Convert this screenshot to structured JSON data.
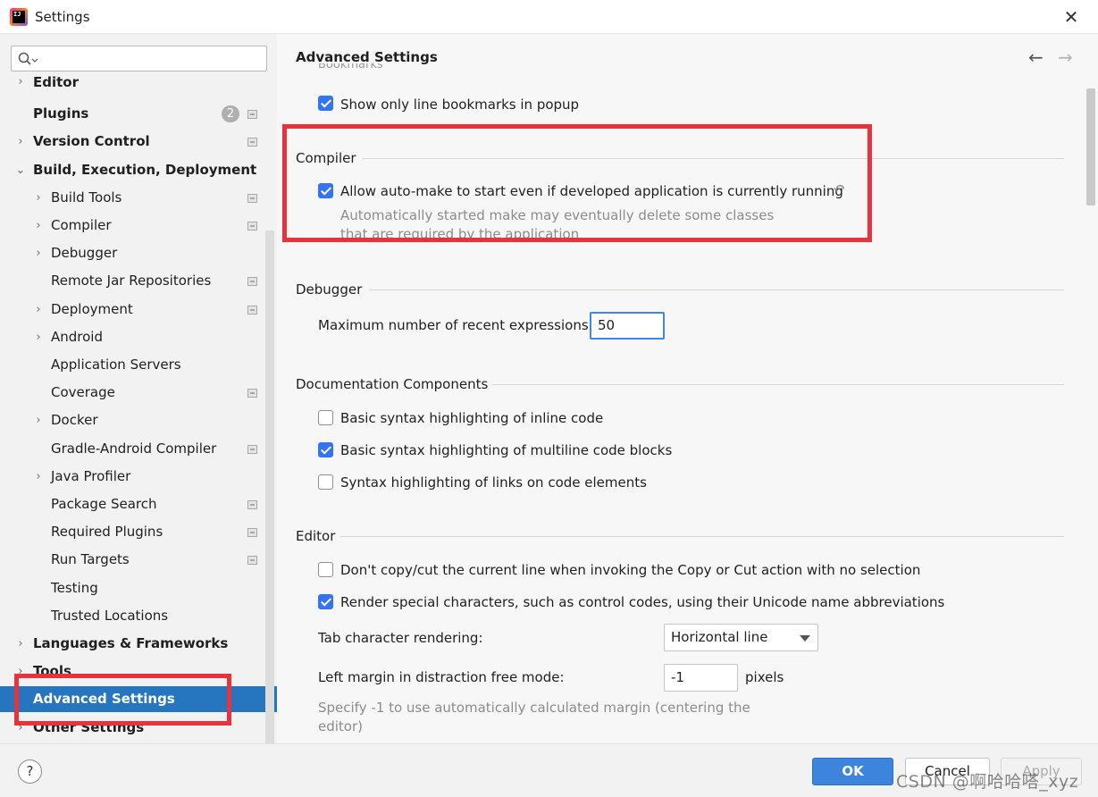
{
  "window": {
    "title": "Settings",
    "close_glyph": "✕"
  },
  "sidebar": {
    "search": {
      "placeholder": "",
      "value": ""
    },
    "items": [
      {
        "label": "Editor",
        "bold": true,
        "chevron": "›",
        "level": 0,
        "clipped": true
      },
      {
        "label": "Plugins",
        "bold": true,
        "chevron": "",
        "level": 0,
        "badge": "2",
        "project": true
      },
      {
        "label": "Version Control",
        "bold": true,
        "chevron": "›",
        "level": 0,
        "project": true
      },
      {
        "label": "Build, Execution, Deployment",
        "bold": true,
        "chevron": "⌄",
        "level": 0
      },
      {
        "label": "Build Tools",
        "bold": false,
        "chevron": "›",
        "level": 1,
        "project": true
      },
      {
        "label": "Compiler",
        "bold": false,
        "chevron": "›",
        "level": 1,
        "project": true
      },
      {
        "label": "Debugger",
        "bold": false,
        "chevron": "›",
        "level": 1
      },
      {
        "label": "Remote Jar Repositories",
        "bold": false,
        "chevron": "",
        "level": 1,
        "project": true
      },
      {
        "label": "Deployment",
        "bold": false,
        "chevron": "›",
        "level": 1,
        "project": true
      },
      {
        "label": "Android",
        "bold": false,
        "chevron": "›",
        "level": 1
      },
      {
        "label": "Application Servers",
        "bold": false,
        "chevron": "",
        "level": 1
      },
      {
        "label": "Coverage",
        "bold": false,
        "chevron": "",
        "level": 1,
        "project": true
      },
      {
        "label": "Docker",
        "bold": false,
        "chevron": "›",
        "level": 1
      },
      {
        "label": "Gradle-Android Compiler",
        "bold": false,
        "chevron": "",
        "level": 1,
        "project": true
      },
      {
        "label": "Java Profiler",
        "bold": false,
        "chevron": "›",
        "level": 1
      },
      {
        "label": "Package Search",
        "bold": false,
        "chevron": "",
        "level": 1,
        "project": true
      },
      {
        "label": "Required Plugins",
        "bold": false,
        "chevron": "",
        "level": 1,
        "project": true
      },
      {
        "label": "Run Targets",
        "bold": false,
        "chevron": "",
        "level": 1,
        "project": true
      },
      {
        "label": "Testing",
        "bold": false,
        "chevron": "",
        "level": 1
      },
      {
        "label": "Trusted Locations",
        "bold": false,
        "chevron": "",
        "level": 1
      },
      {
        "label": "Languages & Frameworks",
        "bold": true,
        "chevron": "›",
        "level": 0
      },
      {
        "label": "Tools",
        "bold": true,
        "chevron": "›",
        "level": 0
      },
      {
        "label": "Advanced Settings",
        "bold": true,
        "chevron": "",
        "level": 0,
        "selected": true
      },
      {
        "label": "Other Settings",
        "bold": true,
        "chevron": "›",
        "level": 0
      }
    ]
  },
  "main": {
    "title": "Advanced Settings",
    "back_glyph": "←",
    "forward_glyph": "→",
    "clipped_group": "Bookmarks",
    "bookmarks": {
      "show_only_line": {
        "label": "Show only line bookmarks in popup",
        "checked": true
      }
    },
    "compiler": {
      "group": "Compiler",
      "auto_make": {
        "label": "Allow auto-make to start even if developed application is currently running",
        "checked": true
      },
      "hint": "Automatically started make may eventually delete some classes that are required by the application",
      "revert_glyph": "↶"
    },
    "debugger": {
      "group": "Debugger",
      "max_expr_label": "Maximum number of recent expressions:",
      "max_expr_value": "50"
    },
    "doc_components": {
      "group": "Documentation Components",
      "inline_code": {
        "label": "Basic syntax highlighting of inline code",
        "checked": false
      },
      "multiline": {
        "label": "Basic syntax highlighting of multiline code blocks",
        "checked": true
      },
      "links": {
        "label": "Syntax highlighting of links on code elements",
        "checked": false
      }
    },
    "editor": {
      "group": "Editor",
      "no_copy_cut": {
        "label": "Don't copy/cut the current line when invoking the Copy or Cut action with no selection",
        "checked": false
      },
      "render_special": {
        "label": "Render special characters, such as control codes, using their Unicode name abbreviations",
        "checked": true
      },
      "tab_render_label": "Tab character rendering:",
      "tab_render_value": "Horizontal line",
      "left_margin_label": "Left margin in distraction free mode:",
      "left_margin_value": "-1",
      "left_margin_unit": "pixels",
      "left_margin_hint": "Specify -1 to use automatically calculated margin (centering the editor)"
    }
  },
  "footer": {
    "help": "?",
    "ok": "OK",
    "cancel": "Cancel",
    "apply": "Apply",
    "watermark": "CSDN @啊哈哈嗒_xyz"
  },
  "colors": {
    "accent": "#3574f0",
    "selection": "#2675bf",
    "highlight_box": "#e8333d"
  }
}
